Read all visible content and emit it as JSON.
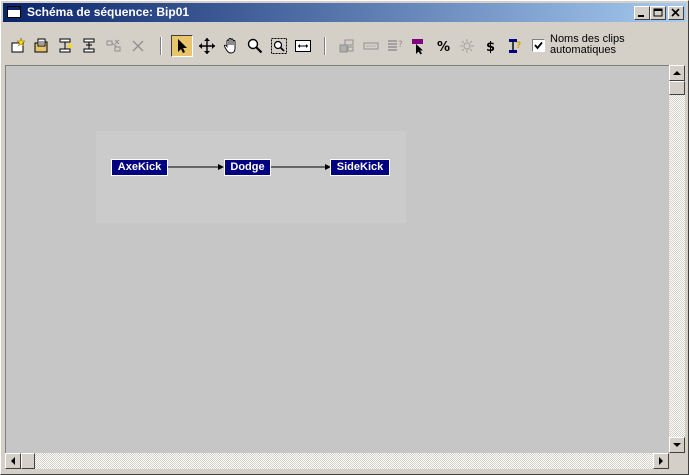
{
  "window": {
    "title": "Schéma de séquence: Bip01",
    "controls": [
      {
        "name": "minimize-button",
        "icon": "minimize-icon"
      },
      {
        "name": "maximize-button",
        "icon": "maximize-icon"
      },
      {
        "name": "close-button",
        "icon": "close-icon"
      }
    ]
  },
  "toolbar": {
    "buttons": [
      {
        "name": "new-script-button",
        "icon": "new-script-icon",
        "enabled": true
      },
      {
        "name": "load-script-button",
        "icon": "open-folder-icon",
        "enabled": true
      },
      {
        "name": "insert-clip-button",
        "icon": "insert-clip-icon",
        "enabled": true
      },
      {
        "name": "insert-transition-button",
        "icon": "insert-transition-icon",
        "enabled": true
      },
      {
        "name": "connect-button",
        "icon": "connect-icon",
        "enabled": false
      },
      {
        "name": "delete-button",
        "icon": "delete-x-icon",
        "enabled": false
      },
      {
        "name": "select-button",
        "icon": "select-arrow-icon",
        "enabled": true,
        "active": true
      },
      {
        "name": "move-button",
        "icon": "move-icon",
        "enabled": true
      },
      {
        "name": "pan-button",
        "icon": "pan-hand-icon",
        "enabled": true
      },
      {
        "name": "zoom-button",
        "icon": "zoom-icon",
        "enabled": true
      },
      {
        "name": "zoom-region-button",
        "icon": "zoom-region-icon",
        "enabled": true
      },
      {
        "name": "zoom-extents-button",
        "icon": "zoom-extents-icon",
        "enabled": true
      },
      {
        "name": "create-multiple-button",
        "icon": "multiple-icon",
        "enabled": false
      },
      {
        "name": "collapse-button",
        "icon": "collapse-icon",
        "enabled": false
      },
      {
        "name": "properties-button",
        "icon": "properties-icon",
        "enabled": false
      },
      {
        "name": "set-start-clip-button",
        "icon": "start-clip-icon",
        "enabled": true
      },
      {
        "name": "random-percentage-button",
        "icon": "percent-icon",
        "enabled": true
      },
      {
        "name": "set-random-start-button",
        "icon": "random-start-icon",
        "enabled": false
      },
      {
        "name": "set-cost-button",
        "icon": "dollar-icon",
        "enabled": true
      },
      {
        "name": "show-clip-info-button",
        "icon": "clip-info-icon",
        "enabled": true
      }
    ],
    "auto_clip_names": {
      "checked": true,
      "line1": "Noms des clips",
      "line2": "automatiques"
    }
  },
  "sequence": {
    "clips": [
      {
        "label": "AxeKick"
      },
      {
        "label": "Dodge"
      },
      {
        "label": "SideKick"
      }
    ],
    "node_color": "#000080"
  },
  "scrollbars": {
    "vertical_icons": [
      "scroll-up-icon",
      "scroll-down-icon"
    ],
    "horizontal_icons": [
      "scroll-left-icon",
      "scroll-right-icon"
    ]
  }
}
